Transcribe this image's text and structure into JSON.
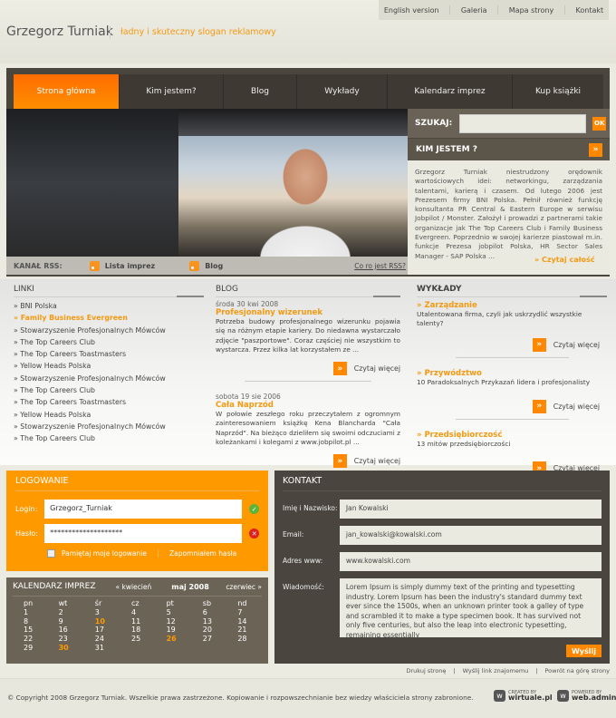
{
  "top_links": [
    "English version",
    "Galeria",
    "Mapa strony",
    "Kontakt"
  ],
  "brand": {
    "name": "Grzegorz Turniak",
    "slogan": "ładny i skuteczny slogan reklamowy"
  },
  "nav": [
    {
      "label": "Strona główna",
      "active": true
    },
    {
      "label": "Kim jestem?"
    },
    {
      "label": "Blog"
    },
    {
      "label": "Wykłady"
    },
    {
      "label": "Kalendarz imprez"
    },
    {
      "label": "Kup książki"
    }
  ],
  "rss": {
    "label": "KANAŁ RSS:",
    "feeds": [
      "Lista imprez",
      "Blog"
    ],
    "help": "Co ro jest RSS?"
  },
  "search": {
    "label": "SZUKAJ:",
    "value": "",
    "button": "OK"
  },
  "about": {
    "title": "KIM JESTEM ?",
    "arrow": "»",
    "text": "Grzegorz Turniak niestrudzony orędownik wartościowych idei: networkingu, zarządzania talentami, karierą i czasem. Od lutego 2006 jest Prezesem firmy BNI Polska. Pełnił również funkcję konsultanta PR Central & Eastern Europe w serwisu Jobpilot / Monster. Założył i prowadzi z partnerami takie organizacje jak The Top Careers Club i Family Business Evergreen. Poprzednio w swojej karierze piastował m.in. funkcje Prezesa jobpilot Polska, HR Sector Sales Manager - SAP Polska ...",
    "more": "» Czytaj całość"
  },
  "links": {
    "title": "LINKI",
    "items": [
      {
        "label": "» BNI Polska"
      },
      {
        "label": "» Family Business Evergreen",
        "highlight": true
      },
      {
        "label": "» Stowarzyszenie Profesjonalnych Mówców"
      },
      {
        "label": "» The Top Careers Club"
      },
      {
        "label": "» The Top Careers Toastmasters"
      },
      {
        "label": "» Yellow Heads Polska"
      },
      {
        "label": "» Stowarzyszenie Profesjonalnych Mówców"
      },
      {
        "label": "» The Top Careers Club"
      },
      {
        "label": "» The Top Careers Toastmasters"
      },
      {
        "label": "» Yellow Heads Polska"
      },
      {
        "label": "» Stowarzyszenie Profesjonalnych Mówców"
      },
      {
        "label": "» The Top Careers Club"
      }
    ]
  },
  "blog": {
    "title": "BLOG",
    "more_label": "Czytaj więcej",
    "posts": [
      {
        "date": "środa 30 kwi 2008",
        "title": "Profesjonalny wizerunek",
        "text": "Potrzeba budowy profesjonalnego wizerunku pojawia się na różnym etapie kariery. Do niedawna wystarczało zdjęcie \"paszportowe\". Coraz częściej nie wszystkim to wystarcza. Przez kilka lat korzystałem ze ..."
      },
      {
        "date": "sobota 19 sie 2006",
        "title": "Cała Naprzód",
        "text": "W połowie zeszłego roku przeczytałem z ogromnym zainteresowaniem książkę Kena Blancharda \"Cała Naprzód\". Na bieżąco dzieliłem się swoimi odczuciami z koleżankami i kolegami z www.jobpilot.pl ..."
      }
    ]
  },
  "lectures": {
    "title": "WYKŁADY",
    "more_label": "Czytaj więcej",
    "items": [
      {
        "title": "» Zarządzanie",
        "text": "Utalentowana firma, czyli jak uskrzydlić wszystkie talenty?"
      },
      {
        "title": "» Przywództwo",
        "text": "10 Paradoksalnych Przykazań lidera i profesjonalisty"
      },
      {
        "title": "» Przedsiębiorczość",
        "text": "13 mitów przedsiębiorczości"
      }
    ]
  },
  "login": {
    "title": "LOGOWANIE",
    "login_label": "Login:",
    "login_value": "Grzegorz_Turniak",
    "password_label": "Hasło:",
    "password_value": "********************",
    "remember": "Pamiętaj moje logowanie",
    "forgot": "Zapomniałem hasła",
    "remember_checked": false
  },
  "calendar": {
    "title": "KALENDARZ IMPREZ",
    "prev": "« kwiecień",
    "current": "maj 2008",
    "next": "czerwiec »",
    "days": [
      "pn",
      "wt",
      "śr",
      "cz",
      "pt",
      "sb",
      "nd"
    ],
    "weeks": [
      [
        "1",
        "2",
        "3",
        "4",
        "5",
        "6",
        "7"
      ],
      [
        "8",
        "9",
        "10",
        "11",
        "12",
        "13",
        "14"
      ],
      [
        "15",
        "16",
        "17",
        "18",
        "19",
        "20",
        "21"
      ],
      [
        "22",
        "23",
        "24",
        "25",
        "26",
        "27",
        "28"
      ],
      [
        "29",
        "30",
        "31",
        "",
        "",
        "",
        ""
      ]
    ],
    "event_days": [
      "10",
      "26",
      "30"
    ]
  },
  "contact": {
    "title": "KONTAKT",
    "fields": [
      {
        "label": "Imię i Nazwisko:",
        "value": "Jan Kowalski"
      },
      {
        "label": "Email:",
        "value": "jan_kowalski@kowalski.com"
      },
      {
        "label": "Adres www:",
        "value": "www.kowalski.com"
      }
    ],
    "message_label": "Wiadomość:",
    "message": "Lorem Ipsum is simply dummy text of the printing and typesetting industry. Lorem Ipsum has been the industry's standard dummy text ever since the 1500s, when an unknown printer took a galley of type and scrambled it to make a type specimen book. It has survived not only five centuries, but also the leap into electronic typesetting, remaining essentially",
    "submit": "Wyślij"
  },
  "footer": {
    "links": [
      "Drukuj stronę",
      "Wyślij link znajomemu",
      "Powrót na górę strony"
    ],
    "copyright": "© Copyright 2008 Grzegorz Turniak. Wszelkie prawa zastrzeżone. Kopiowanie i rozpowszechnianie bez wiedzy właściciela strony zabronione.",
    "badges": [
      {
        "caption": "CREATED BY",
        "name": "wirtuale.pl"
      },
      {
        "caption": "POWERED BY",
        "name": "web.admin"
      }
    ]
  },
  "colors": {
    "accent": "#ff9900",
    "dark": "#4a463e",
    "calendar": "#6b6356"
  }
}
